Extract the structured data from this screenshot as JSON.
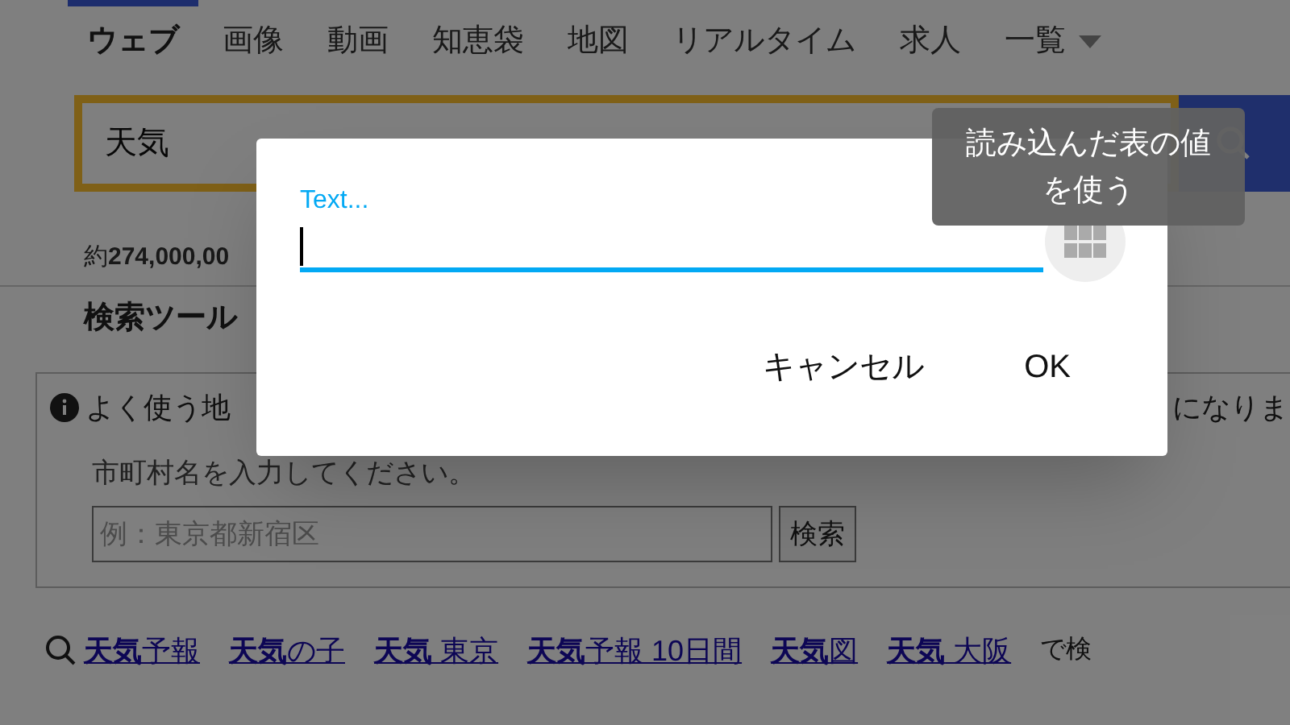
{
  "tabs": [
    {
      "label": "ウェブ",
      "selected": true
    },
    {
      "label": "画像",
      "selected": false
    },
    {
      "label": "動画",
      "selected": false
    },
    {
      "label": "知恵袋",
      "selected": false
    },
    {
      "label": "地図",
      "selected": false
    },
    {
      "label": "リアルタイム",
      "selected": false
    },
    {
      "label": "求人",
      "selected": false
    },
    {
      "label": "一覧",
      "selected": false,
      "kind": "dropdown"
    }
  ],
  "search": {
    "value": "天気"
  },
  "result_count": "約**274,000,00**",
  "tools_heading": "検索ツール",
  "notice": {
    "start": "よく使う地",
    "end": "になりま",
    "prompt": "市町村名を入力してください。",
    "placeholder": "例：東京都新宿区",
    "button": "検索"
  },
  "related": {
    "items": [
      "**天気**予報",
      "**天気**の子",
      "**天気** 東京",
      "**天気**予報 10日間",
      "**天気**図",
      "**天気** 大阪"
    ],
    "suffix": "で検"
  },
  "dialog": {
    "label": "Text...",
    "tooltip": "読み込んだ表の値を使う",
    "buttons": [
      "キャンセル",
      "OK"
    ]
  }
}
